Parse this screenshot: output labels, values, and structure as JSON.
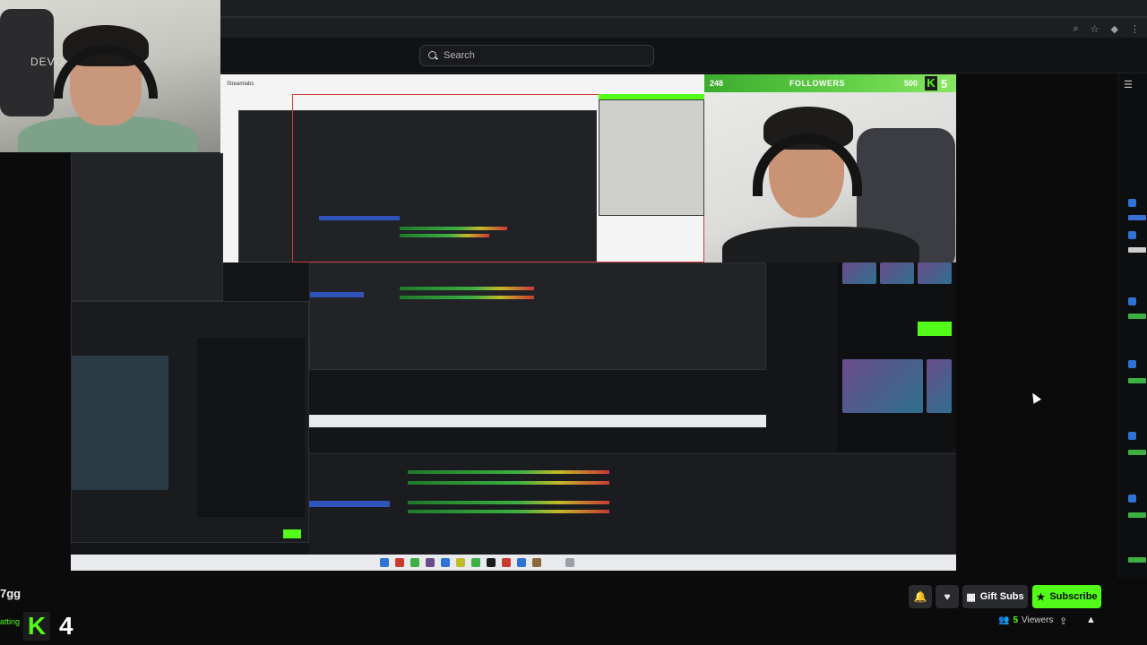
{
  "search": {
    "placeholder": "Search"
  },
  "webcam": {
    "logo": "DEVO"
  },
  "stream": {
    "followers_bar": {
      "current": "248",
      "label": "FOLLOWERS",
      "goal": "500",
      "k_count": "5"
    },
    "window_title": "Streamlabs"
  },
  "channel": {
    "name": "7gg",
    "category": "atting"
  },
  "overlay": {
    "k_count": "4"
  },
  "actions": {
    "gift_label": "Gift Subs",
    "subscribe_label": "Subscribe",
    "viewers_count": "5",
    "viewers_label": "Viewers"
  },
  "colors": {
    "accent": "#53fc18",
    "background": "#0b0b0c"
  }
}
